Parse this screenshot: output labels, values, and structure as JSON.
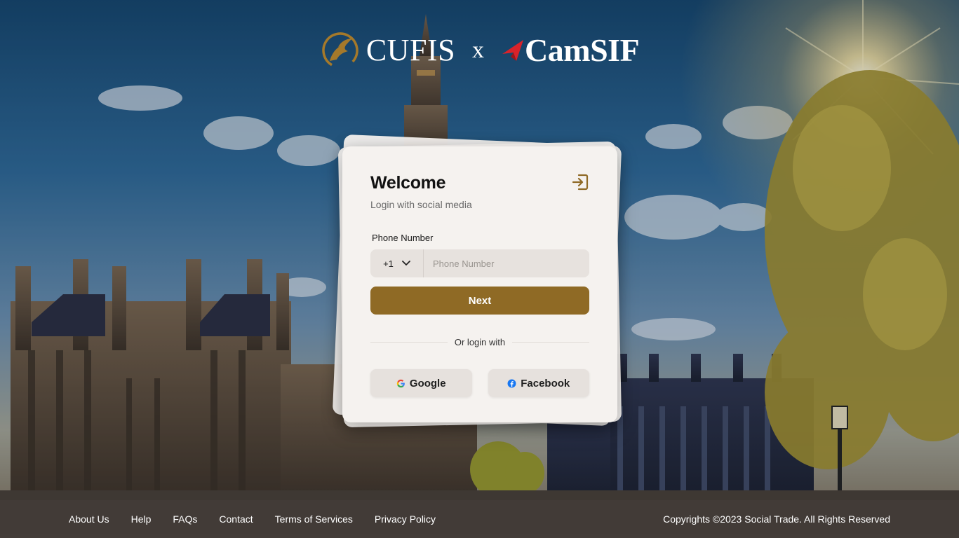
{
  "brand": {
    "primary_name": "CUFIS",
    "separator": "x",
    "partner_name": "CamSIF",
    "primary_mark_icon": "cufis-horse-logo-icon",
    "partner_mark_icon": "camsif-red-swoosh-icon",
    "colors": {
      "gold": "#8f6a25",
      "red": "#d9232a"
    }
  },
  "card": {
    "title": "Welcome",
    "subtitle": "Login with social media",
    "login_icon": "sign-in-icon",
    "phone": {
      "label": "Phone Number",
      "country_code": "+1",
      "placeholder": "Phone Number",
      "value": ""
    },
    "next_label": "Next",
    "divider_text": "Or login with",
    "social": [
      {
        "label": "Google",
        "icon": "google-icon"
      },
      {
        "label": "Facebook",
        "icon": "facebook-icon"
      }
    ]
  },
  "footer": {
    "links": [
      "About Us",
      "Help",
      "FAQs",
      "Contact",
      "Terms of Services",
      "Privacy Policy"
    ],
    "copyright": "Copyrights ©2023 Social Trade. All Rights Reserved"
  }
}
